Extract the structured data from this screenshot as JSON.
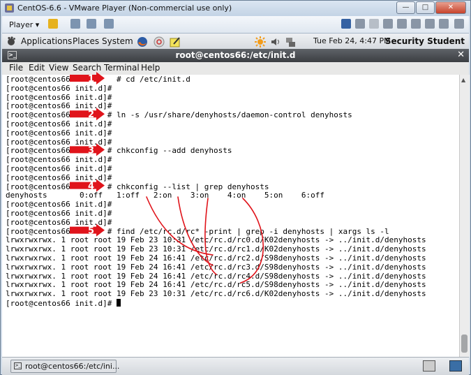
{
  "window": {
    "title": "CentOS-6.6 - VMware Player (Non-commercial use only)"
  },
  "vmware": {
    "player_label": "Player ▾"
  },
  "panel": {
    "applications": "Applications",
    "places": "Places",
    "system": "System",
    "datetime": "Tue Feb 24,  4:47 PM",
    "user": "Security Student"
  },
  "terminal": {
    "title": "root@centos66:/etc/init.d",
    "menu": [
      "File",
      "Edit",
      "View",
      "Search",
      "Terminal",
      "Help"
    ],
    "lines": [
      "[root@centos66 der      # cd /etc/init.d",
      "[root@centos66 init.d]#",
      "[root@centos66 init.d]#",
      "[root@centos66 init.d]#",
      "[root@centos66        # ln -s /usr/share/denyhosts/daemon-control denyhosts",
      "[root@centos66 init.d]#",
      "[root@centos66 init.d]#",
      "[root@centos66 init.d]#",
      "[root@centos66        # chkconfig --add denyhosts",
      "[root@centos66 init.d]#",
      "[root@centos66 init.d]#",
      "[root@centos66 init.d]#",
      "[root@centos66        # chkconfig --list | grep denyhosts",
      "denyhosts       0:off   1:off   2:on    3:on    4:on    5:on    6:off",
      "[root@centos66 init.d]#",
      "[root@centos66 init.d]#",
      "[root@centos66 init.d]#",
      "[root@centos66        # find /etc/rc.d/rc* -print | grep -i denyhosts | xargs ls -l",
      "lrwxrwxrwx. 1 root root 19 Feb 23 10:31 /etc/rc.d/rc0.d/K02denyhosts -> ../init.d/denyhosts",
      "lrwxrwxrwx. 1 root root 19 Feb 23 10:31 /etc/rc.d/rc1.d/K02denyhosts -> ../init.d/denyhosts",
      "lrwxrwxrwx. 1 root root 19 Feb 24 16:41 /etc/rc.d/rc2.d/S98denyhosts -> ../init.d/denyhosts",
      "lrwxrwxrwx. 1 root root 19 Feb 24 16:41 /etc/rc.d/rc3.d/S98denyhosts -> ../init.d/denyhosts",
      "lrwxrwxrwx. 1 root root 19 Feb 24 16:41 /etc/rc.d/rc4.d/S98denyhosts -> ../init.d/denyhosts",
      "lrwxrwxrwx. 1 root root 19 Feb 24 16:41 /etc/rc.d/rc5.d/S98denyhosts -> ../init.d/denyhosts",
      "lrwxrwxrwx. 1 root root 19 Feb 23 10:31 /etc/rc.d/rc6.d/K02denyhosts -> ../init.d/denyhosts",
      "[root@centos66 init.d]# "
    ]
  },
  "annotations": {
    "color": "#e0141b",
    "steps": [
      "1",
      "2",
      "3",
      "4",
      "5"
    ]
  },
  "taskbar": {
    "item": "root@centos66:/etc/ini..."
  }
}
